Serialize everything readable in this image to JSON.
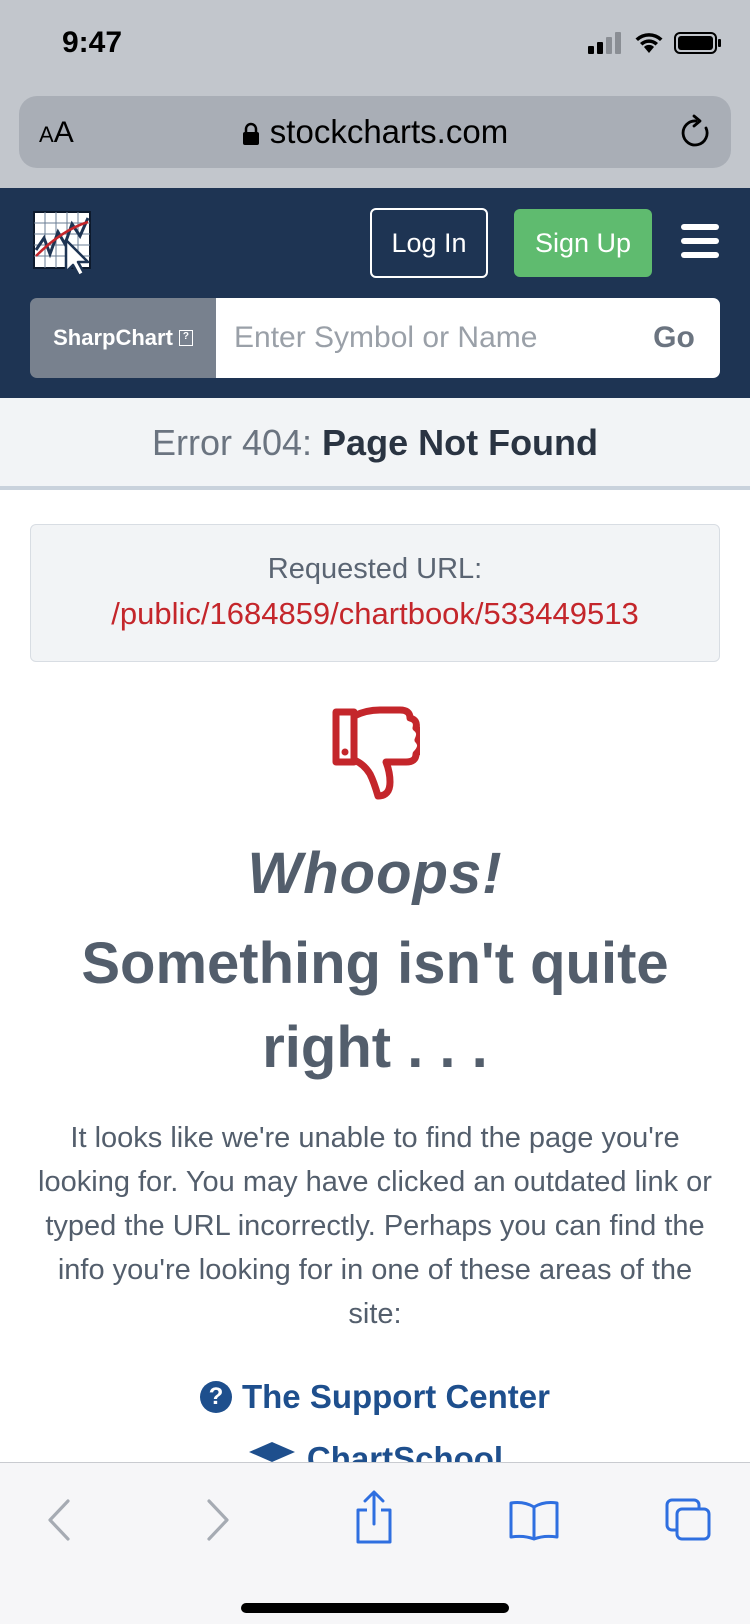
{
  "status_bar": {
    "time": "9:47",
    "icons": [
      "cellular-signal-icon",
      "wifi-icon",
      "battery-icon"
    ]
  },
  "browser": {
    "text_size_label_small": "A",
    "text_size_label_large": "A",
    "url_host": "stockcharts.com"
  },
  "header": {
    "login_label": "Log In",
    "signup_label": "Sign Up",
    "brand_color": "#1e3453",
    "signup_color": "#5fbb6f"
  },
  "search": {
    "chart_type_label": "SharpChart",
    "placeholder": "Enter Symbol or Name",
    "go_label": "Go"
  },
  "error": {
    "prefix": "Error 404:",
    "title": "Page Not Found"
  },
  "requested": {
    "label": "Requested URL:",
    "url": "/public/1684859/chartbook/533449513",
    "url_color": "#c4262b"
  },
  "message": {
    "whoops": "Whoops!",
    "headline": "Something isn't quite right . . .",
    "body": "It looks like we're unable to find the page you're looking for. You may have clicked an outdated link or typed the URL incorrectly. Perhaps you can find the info you're looking for in one of these areas of the site:"
  },
  "links": {
    "support_center": "The Support Center",
    "chart_school": "ChartSchool"
  }
}
